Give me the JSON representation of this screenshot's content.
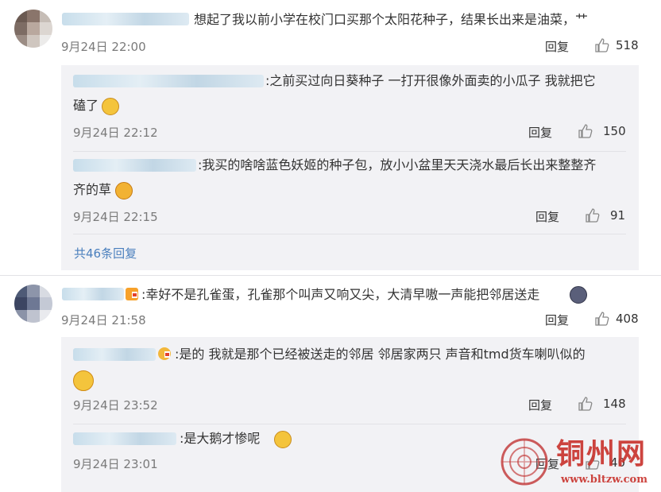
{
  "comments": [
    {
      "text": "想起了我以前小学在校门口买那个太阳花种子，结果长出来是油菜，艹",
      "time": "9月24日 22:00",
      "reply_label": "回复",
      "likes": "518",
      "replies": [
        {
          "text_line1": ":之前买过向日葵种子 一打开很像外面卖的小瓜子 我就把它",
          "text_line2": "磕了",
          "time": "9月24日 22:12",
          "reply_label": "回复",
          "likes": "150"
        },
        {
          "text_line1": ":我买的啥啥蓝色妖姬的种子包，放小小盆里天天浇水最后长出来整整齐",
          "text_line2": "齐的草",
          "time": "9月24日 22:15",
          "reply_label": "回复",
          "likes": "91"
        }
      ],
      "more_label": "共46条回复"
    },
    {
      "text": ":幸好不是孔雀蛋，孔雀那个叫声又响又尖，大清早嗷一声能把邻居送走",
      "time": "9月24日 21:58",
      "reply_label": "回复",
      "likes": "408",
      "replies": [
        {
          "text_line1": ":是的 我就是那个已经被送走的邻居 邻居家两只 声音和tmd货车喇叭似的",
          "text_line2": "",
          "time": "9月24日 23:52",
          "reply_label": "回复",
          "likes": "148"
        },
        {
          "text_line1": ":是大鹅才惨呢",
          "text_line2": "",
          "time": "9月24日 23:01",
          "reply_label": "回复",
          "likes": "40"
        }
      ]
    }
  ],
  "watermark": {
    "name": "铜州网",
    "url": "www.bltzw.com"
  },
  "colors": {
    "link": "#4a7fbd",
    "panel": "#f2f2f5",
    "text": "#333333",
    "muted": "#7a7a7a"
  }
}
